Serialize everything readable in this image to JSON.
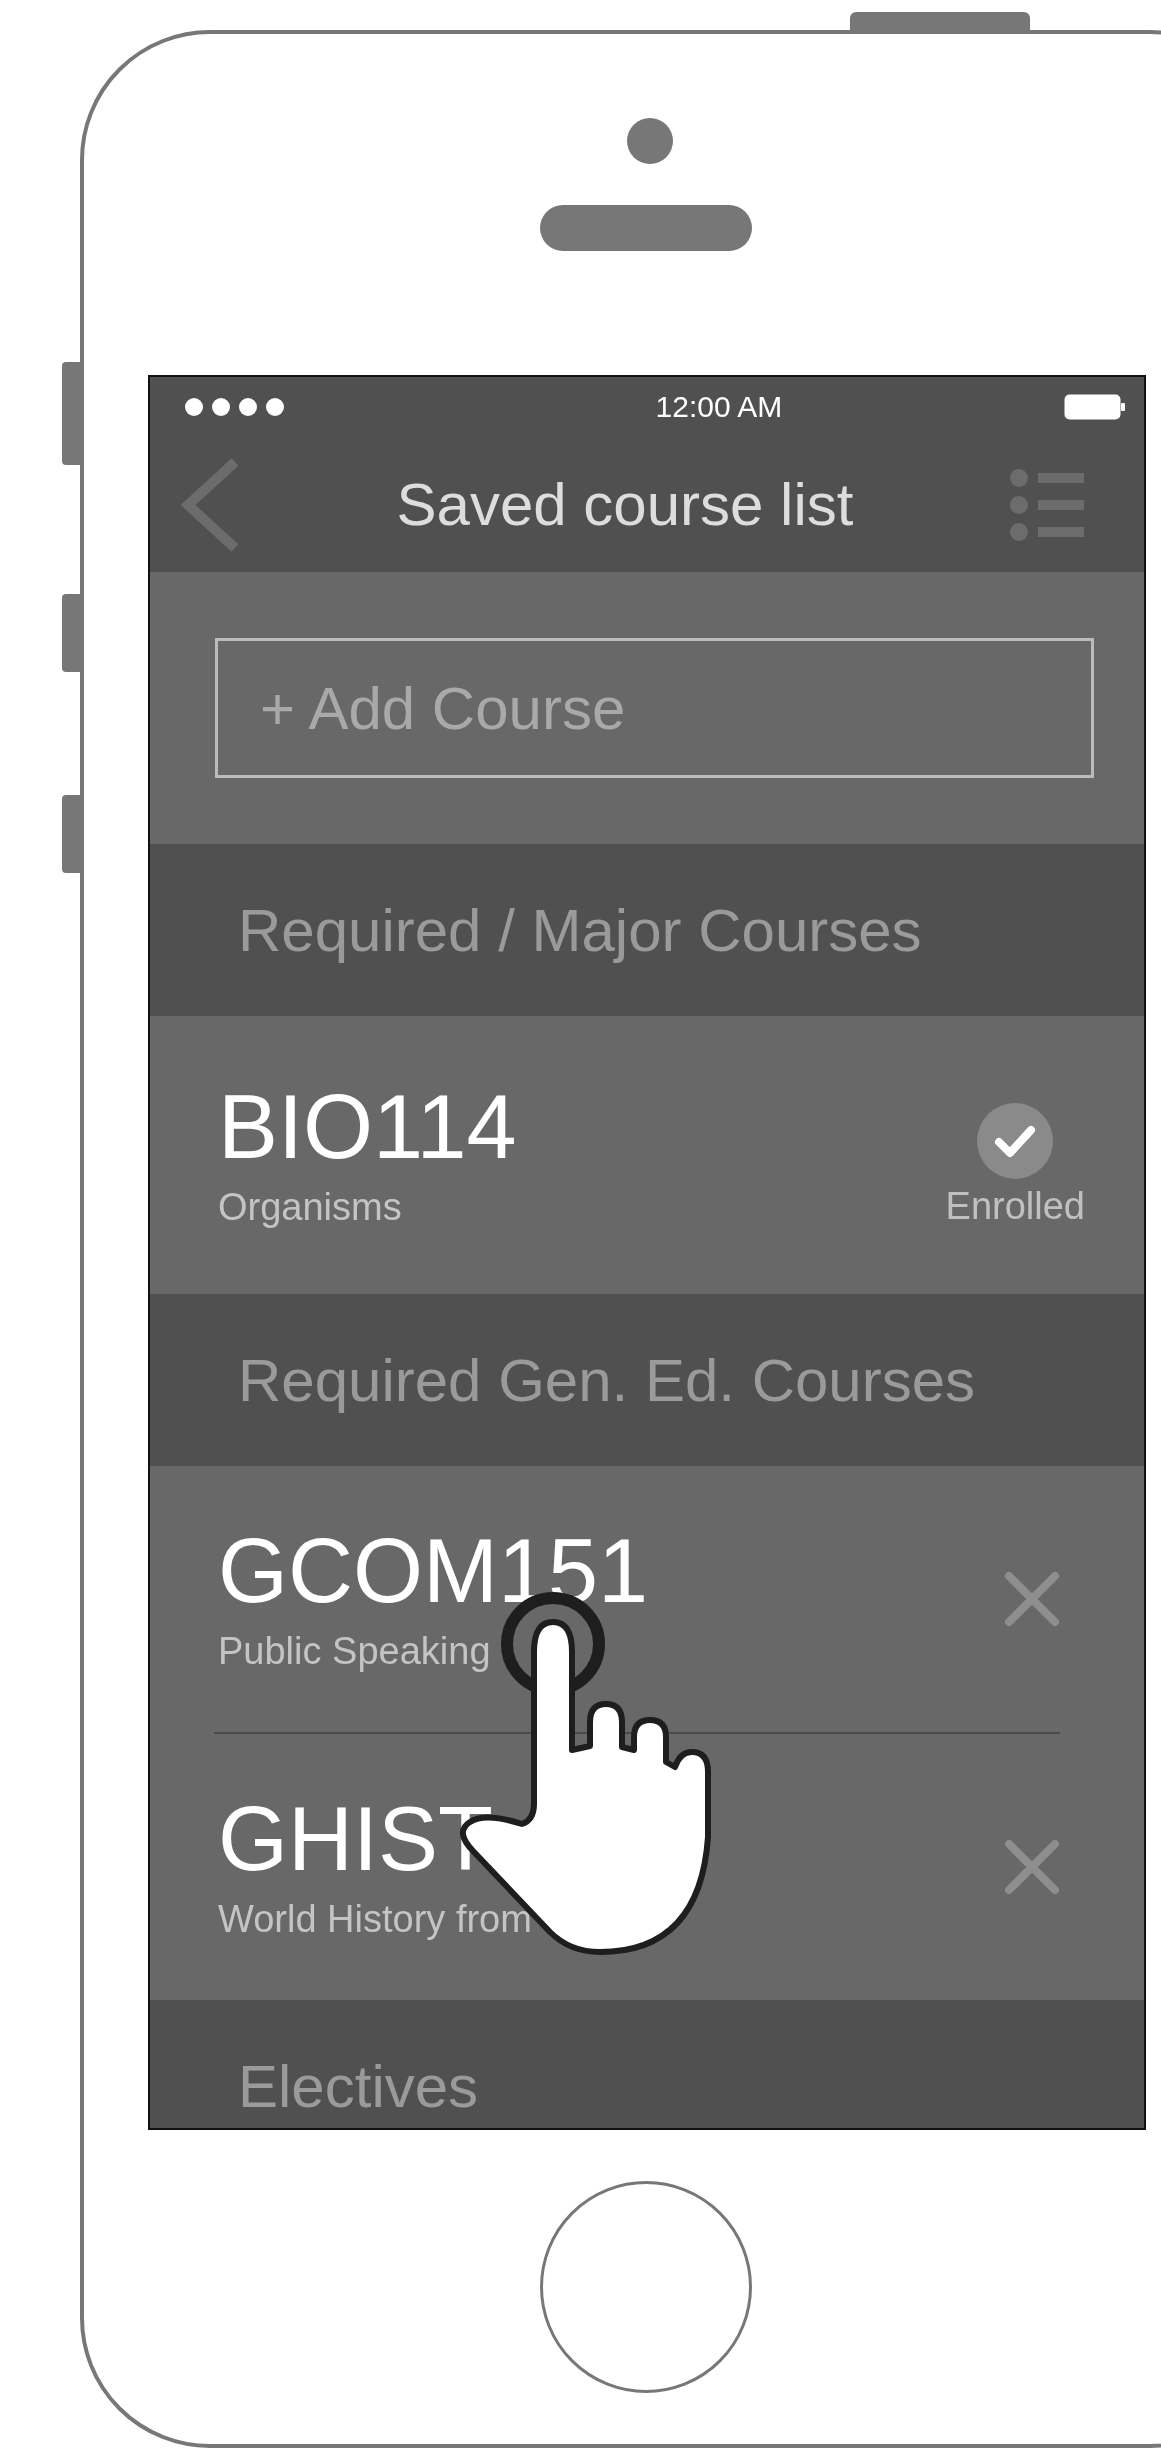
{
  "status_bar": {
    "time": "12:00 AM"
  },
  "nav": {
    "title": "Saved course list"
  },
  "add_field": {
    "placeholder": "+ Add Course"
  },
  "sections": [
    {
      "title": "Required / Major Courses",
      "courses": [
        {
          "kind": "enrolled",
          "code": "BIO114",
          "name": "Organisms",
          "status": "Enrolled"
        }
      ]
    },
    {
      "title": "Required Gen. Ed. Courses",
      "courses": [
        {
          "kind": "removable",
          "code": "GCOM151",
          "name": "Public Speaking"
        },
        {
          "kind": "removable",
          "code": "GHIST",
          "name": "World History from"
        }
      ]
    },
    {
      "title": "Electives"
    }
  ]
}
